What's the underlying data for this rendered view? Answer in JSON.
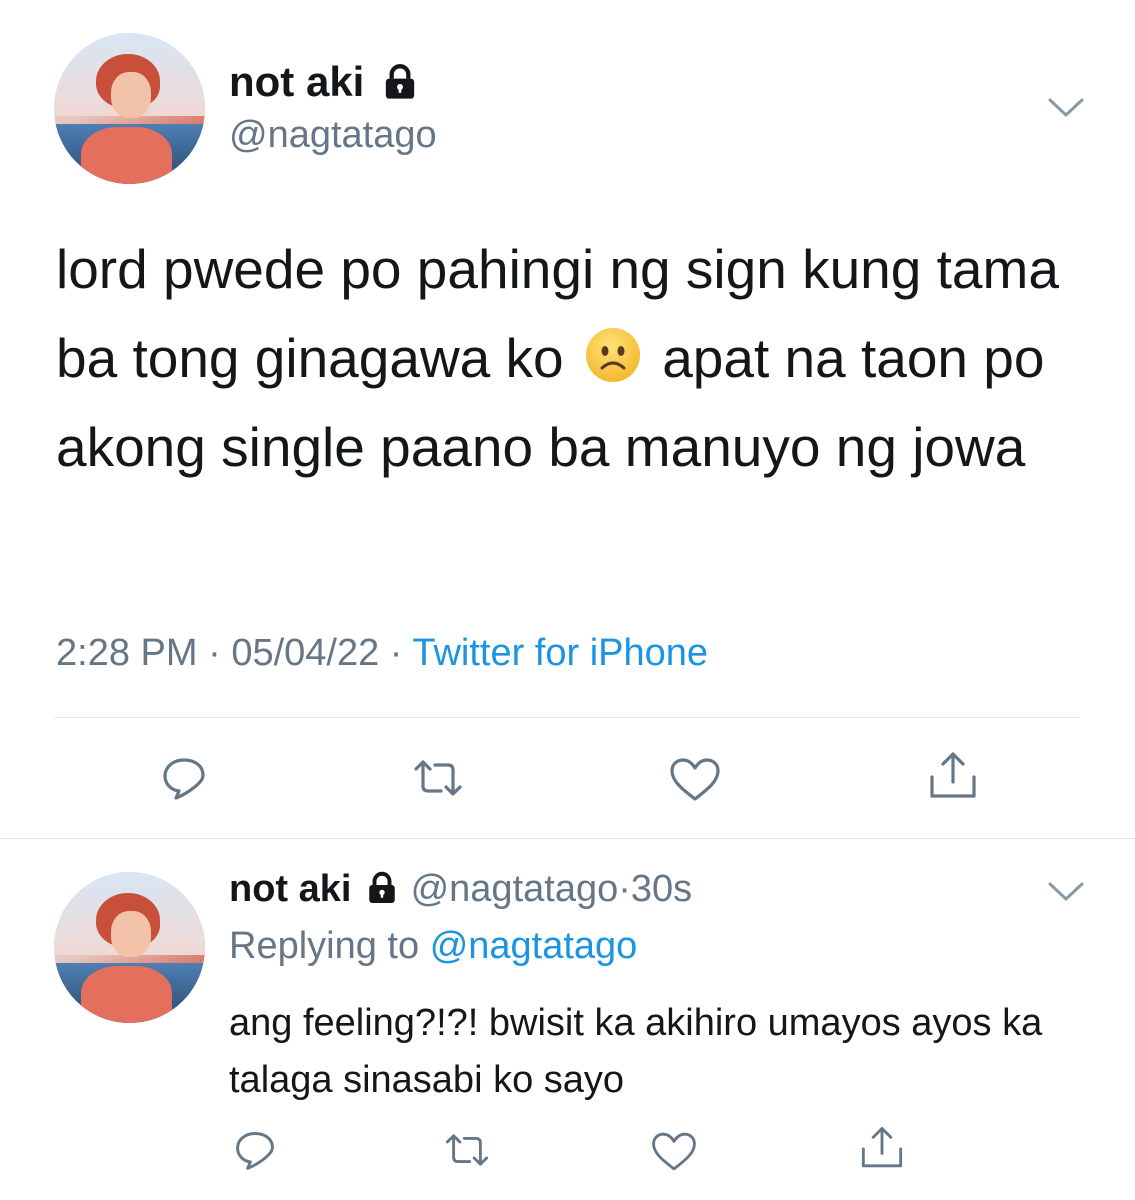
{
  "main_tweet": {
    "display_name": "not aki",
    "handle": "@nagtatago",
    "text_parts": {
      "before_emoji": "lord pwede po pahingi ng sign kung tama ba tong ginagawa ko",
      "emoji": "☹️",
      "after_emoji": "apat na taon po akong single paano ba manuyo ng jowa"
    },
    "time": "2:28 PM",
    "date": "05/04/22",
    "source": "Twitter for iPhone",
    "separator": "·"
  },
  "reply_tweet": {
    "display_name": "not aki",
    "handle": "@nagtatago",
    "separator": "·",
    "age": "30s",
    "replying_prefix": "Replying to",
    "replying_handle": "@nagtatago",
    "text": "ang feeling?!?! bwisit ka akihiro umayos ayos ka talaga sinasabi ko sayo"
  },
  "icons": {
    "lock": "lock-icon",
    "chevron": "chevron-down-icon",
    "reply": "reply-icon",
    "retweet": "retweet-icon",
    "like": "heart-icon",
    "share": "share-icon"
  },
  "colors": {
    "text": "#14171a",
    "secondary": "#657786",
    "link": "#1b95e0",
    "divider": "#e1e8ed",
    "icon": "#657786"
  }
}
